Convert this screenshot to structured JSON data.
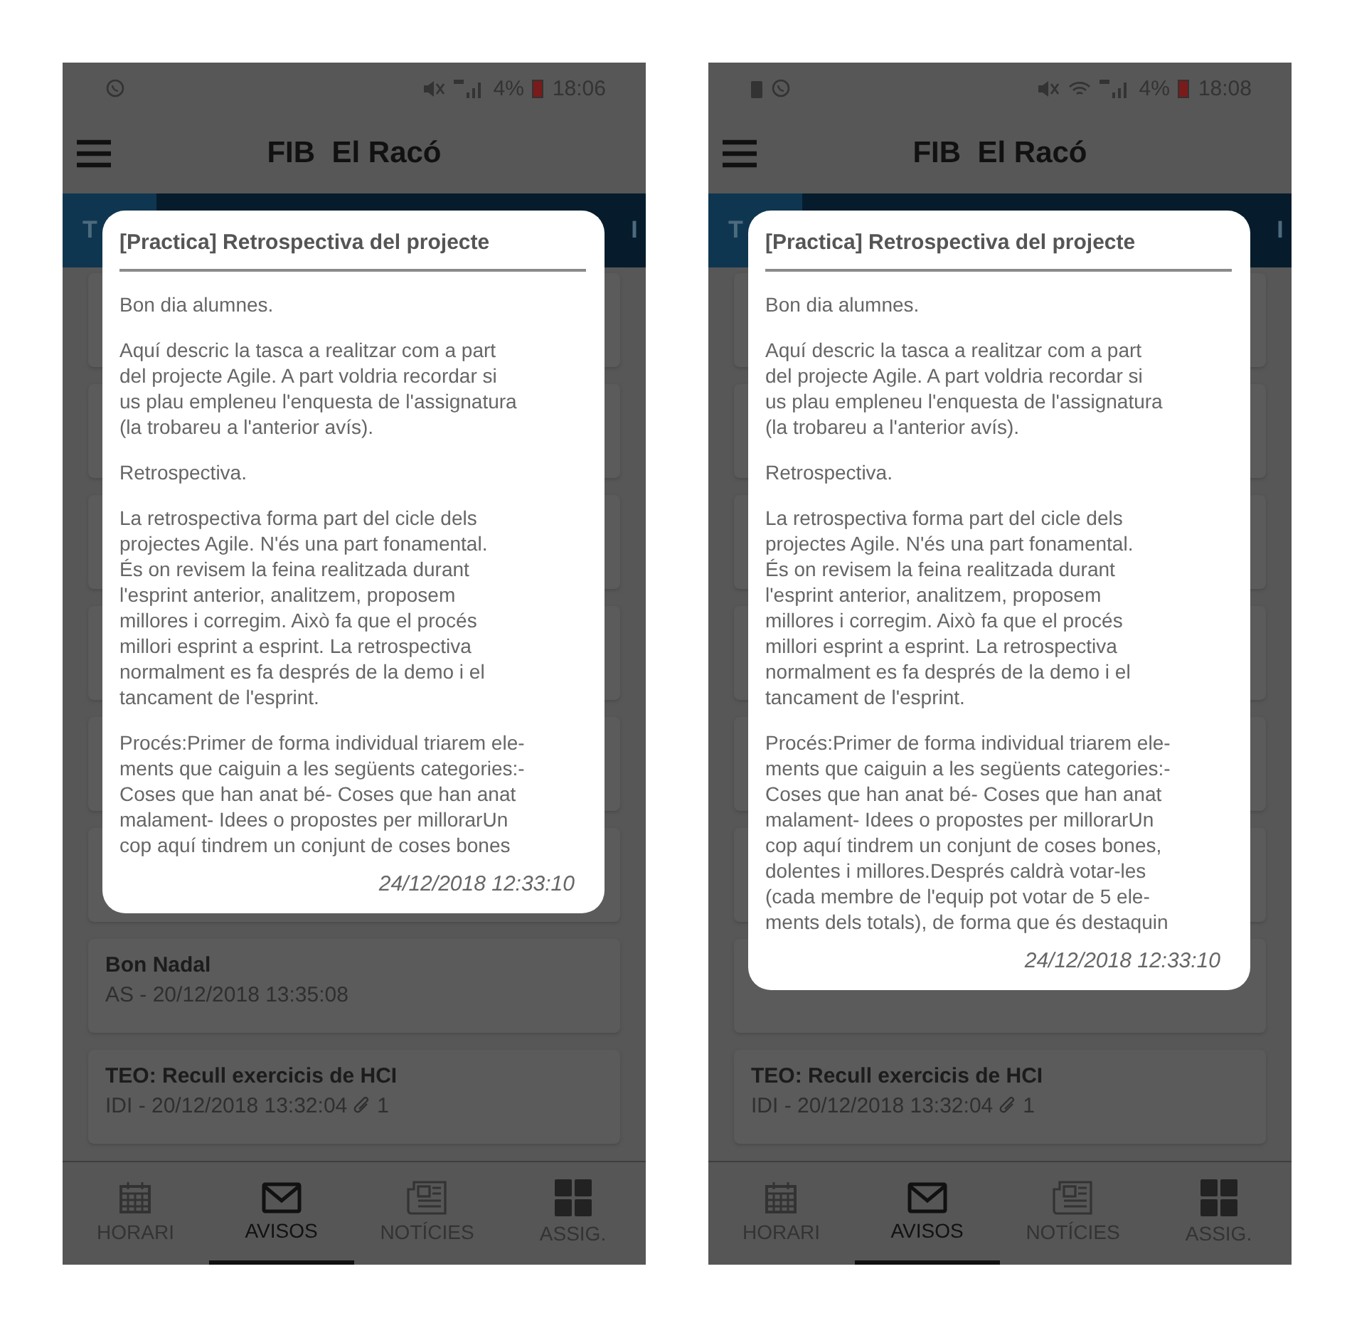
{
  "phones": [
    {
      "status": {
        "notification_icons": [
          {
            "kind": "chat"
          }
        ],
        "system_icons": [
          {
            "kind": "mute"
          },
          {
            "kind": "signal"
          }
        ],
        "battery": "4%",
        "time": "18:06"
      },
      "app_bar": {
        "title": "FIB  El Racó"
      },
      "tabs": [
        {
          "label": "T",
          "selected": true
        },
        {
          "label": "I",
          "selected": false
        }
      ],
      "dialog": {
        "title": "[Practica] Retrospectiva del projecte",
        "paragraphs": [
          "Bon dia alumnes.",
          "Aquí descric la tasca a realitzar com a part\ndel projecte Agile. A part voldria recordar si\nus plau empleneu l'enquesta de l'assignatura\n(la trobareu a l'anterior avís).",
          "Retrospectiva.",
          "La retrospectiva forma part del cicle dels\nprojectes Agile. N'és una part fonamental.\nÉs on revisem la feina realitzada durant\nl'esprint anterior, analitzem, proposem\nmillores i corregim. Això fa que el procés\nmillori esprint a esprint. La retrospectiva\nnormalment es fa després de la demo i el\ntancament de l'esprint.",
          "Procés:Primer de forma individual triarem ele-\nments que caiguin a les següents categories:-\nCoses que han anat bé- Coses que han anat\nmalament- Idees o propostes per millorarUn\ncop aquí tindrem un conjunt de coses bones"
        ],
        "date": "24/12/2018 12:33:10"
      },
      "notices": [
        {
          "title": "Bon Nadal",
          "meta": "AS - 20/12/2018 13:35:08"
        },
        {
          "title": "TEO: Recull exercicis de HCI",
          "meta": "IDI - 20/12/2018 13:32:04",
          "attachments": "1"
        }
      ],
      "nav": [
        {
          "label": "HORARI",
          "selected": false
        },
        {
          "label": "AVISOS",
          "selected": true
        },
        {
          "label": "NOTÍCIES",
          "selected": false
        },
        {
          "label": "ASSIG.",
          "selected": false
        }
      ]
    },
    {
      "status": {
        "notification_icons": [
          {
            "kind": "battery"
          },
          {
            "kind": "chat"
          }
        ],
        "system_icons": [
          {
            "kind": "mute"
          },
          {
            "kind": "wifi"
          },
          {
            "kind": "signal"
          }
        ],
        "battery": "4%",
        "time": "18:08"
      },
      "app_bar": {
        "title": "FIB  El Racó"
      },
      "tabs": [
        {
          "label": "T",
          "selected": true
        },
        {
          "label": "I",
          "selected": false
        }
      ],
      "dialog": {
        "title": "[Practica] Retrospectiva del projecte",
        "paragraphs": [
          "Bon dia alumnes.",
          "Aquí descric la tasca a realitzar com a part\ndel projecte Agile. A part voldria recordar si\nus plau empleneu l'enquesta de l'assignatura\n(la trobareu a l'anterior avís).",
          "Retrospectiva.",
          "La retrospectiva forma part del cicle dels\nprojectes Agile. N'és una part fonamental.\nÉs on revisem la feina realitzada durant\nl'esprint anterior, analitzem, proposem\nmillores i corregim. Això fa que el procés\nmillori esprint a esprint. La retrospectiva\nnormalment es fa després de la demo i el\ntancament de l'esprint.",
          "Procés:Primer de forma individual triarem ele-\nments que caiguin a les següents categories:-\nCoses que han anat bé- Coses que han anat\nmalament- Idees o propostes per millorarUn\ncop aquí tindrem un conjunt de coses bones,\ndolentes i millores.Després caldrà votar-les\n(cada membre de l'equip pot votar de 5 ele-\nments dels totals), de forma que és destaquin"
        ],
        "date": "24/12/2018 12:33:10"
      },
      "notices": [
        {
          "title": "TEO: Recull exercicis de HCI",
          "meta": "IDI - 20/12/2018 13:32:04",
          "attachments": "1"
        }
      ],
      "nav": [
        {
          "label": "HORARI",
          "selected": false
        },
        {
          "label": "AVISOS",
          "selected": true
        },
        {
          "label": "NOTÍCIES",
          "selected": false
        },
        {
          "label": "ASSIG.",
          "selected": false
        }
      ]
    }
  ]
}
